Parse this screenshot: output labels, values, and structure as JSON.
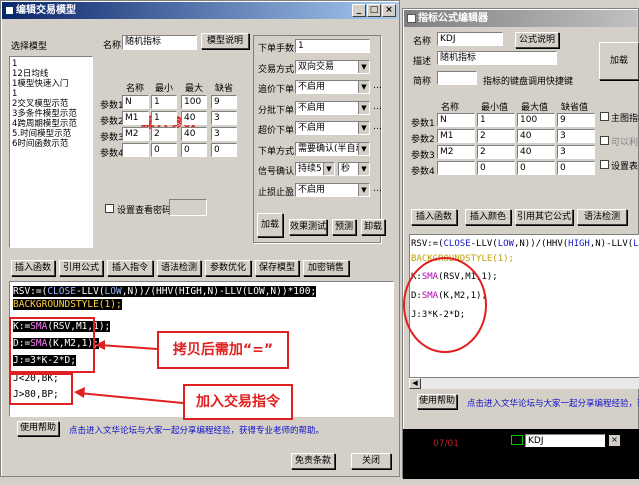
{
  "left": {
    "title": "编辑交易模型",
    "select_label": "选择模型",
    "model_list": [
      "1",
      "12日均线",
      "1模型快速入门",
      "1",
      "2交叉模型示范",
      "3多条件模型示范",
      "4跨周期模型示范",
      "5.时间模型示范",
      "6时间函数示范"
    ],
    "name_label": "名称",
    "name_value": "随机指标",
    "model_desc_btn": "模型说明",
    "param_headers": [
      "名称",
      "最小",
      "最大",
      "缺省"
    ],
    "params": [
      {
        "label": "参数1",
        "name": "N",
        "min": "1",
        "max": "100",
        "def": "9"
      },
      {
        "label": "参数2",
        "name": "M1",
        "min": "1",
        "max": "40",
        "def": "3"
      },
      {
        "label": "参数3",
        "name": "M2",
        "min": "2",
        "max": "40",
        "def": "3"
      },
      {
        "label": "参数4",
        "name": "",
        "min": "0",
        "max": "0",
        "def": "0"
      }
    ],
    "param_annot": "输入参数",
    "right_fields": [
      {
        "label": "下单手数",
        "value": "1"
      },
      {
        "label": "交易方式",
        "value": "双向交易"
      },
      {
        "label": "追价下单",
        "value": "不启用"
      },
      {
        "label": "分批下单",
        "value": "不启用"
      },
      {
        "label": "超价下单",
        "value": "不启用"
      },
      {
        "label": "下单方式",
        "value": "需要确认(半自动)"
      },
      {
        "label": "信号确认",
        "value": "持续5",
        "unit": "秒"
      },
      {
        "label": "止损止盈",
        "value": "不启用"
      }
    ],
    "pwd_label": "设置查看密码",
    "btns_a": [
      "加载",
      "效果测试",
      "预测",
      "卸载"
    ],
    "toolbar": [
      "插入函数",
      "引用公式",
      "插入指令",
      "语法检测",
      "参数优化",
      "保存模型",
      "加密销售"
    ],
    "code": [
      "RSV:=(CLOSE-LLV(LOW,N))/(HHV(HIGH,N)-LLV(LOW,N))*100;",
      "BACKGROUNDSTYLE(1);",
      "K:=SMA(RSV,M1,1);",
      "D:=SMA(K,M2,1);",
      "J:=3*K-2*D;",
      "J<20,BK;",
      "J>80,BP;"
    ],
    "annot_copy": "拷贝后需加“=”",
    "annot_trade": "加入交易指令",
    "help_btn": "使用帮助",
    "help_link": "点击进入文华论坛与大家一起分享编程经验，获得专业老师的帮助。",
    "bottom_btns": [
      "免责条款",
      "关闭"
    ]
  },
  "right": {
    "title": "指标公式编辑器",
    "name_label": "名称",
    "name_value": "KDJ",
    "formula_desc_btn": "公式说明",
    "desc_label": "描述",
    "desc_value": "随机指标",
    "short_label": "简称",
    "short_hint": "指标的键盘调用快捷键",
    "load_btn": "加载",
    "param_headers": [
      "名称",
      "最小值",
      "最大值",
      "缺省值"
    ],
    "params": [
      {
        "label": "参数1",
        "name": "N",
        "min": "1",
        "max": "100",
        "def": "9"
      },
      {
        "label": "参数2",
        "name": "M1",
        "min": "2",
        "max": "40",
        "def": "3"
      },
      {
        "label": "参数3",
        "name": "M2",
        "min": "2",
        "max": "40",
        "def": "3"
      },
      {
        "label": "参数4",
        "name": "",
        "min": "0",
        "max": "0",
        "def": "0"
      }
    ],
    "checks": [
      "主图指标",
      "可以利",
      "设置表"
    ],
    "toolbar": [
      "插入函数",
      "插入颜色",
      "引用其它公式",
      "语法检测"
    ],
    "code": [
      "RSV:=(CLOSE-LLV(LOW,N))/(HHV(HIGH,N)-LLV(LOW,N",
      "BACKGROUNDSTYLE(1);",
      "K:SMA(RSV,M1,1);",
      "D:SMA(K,M2,1);",
      "J:3*K-2*D;"
    ],
    "help_btn": "使用帮助",
    "help_link": "点击进入文华论坛与大家一起分享编程经验，获得",
    "status_date": "07/01",
    "status_name": "KDJ"
  }
}
